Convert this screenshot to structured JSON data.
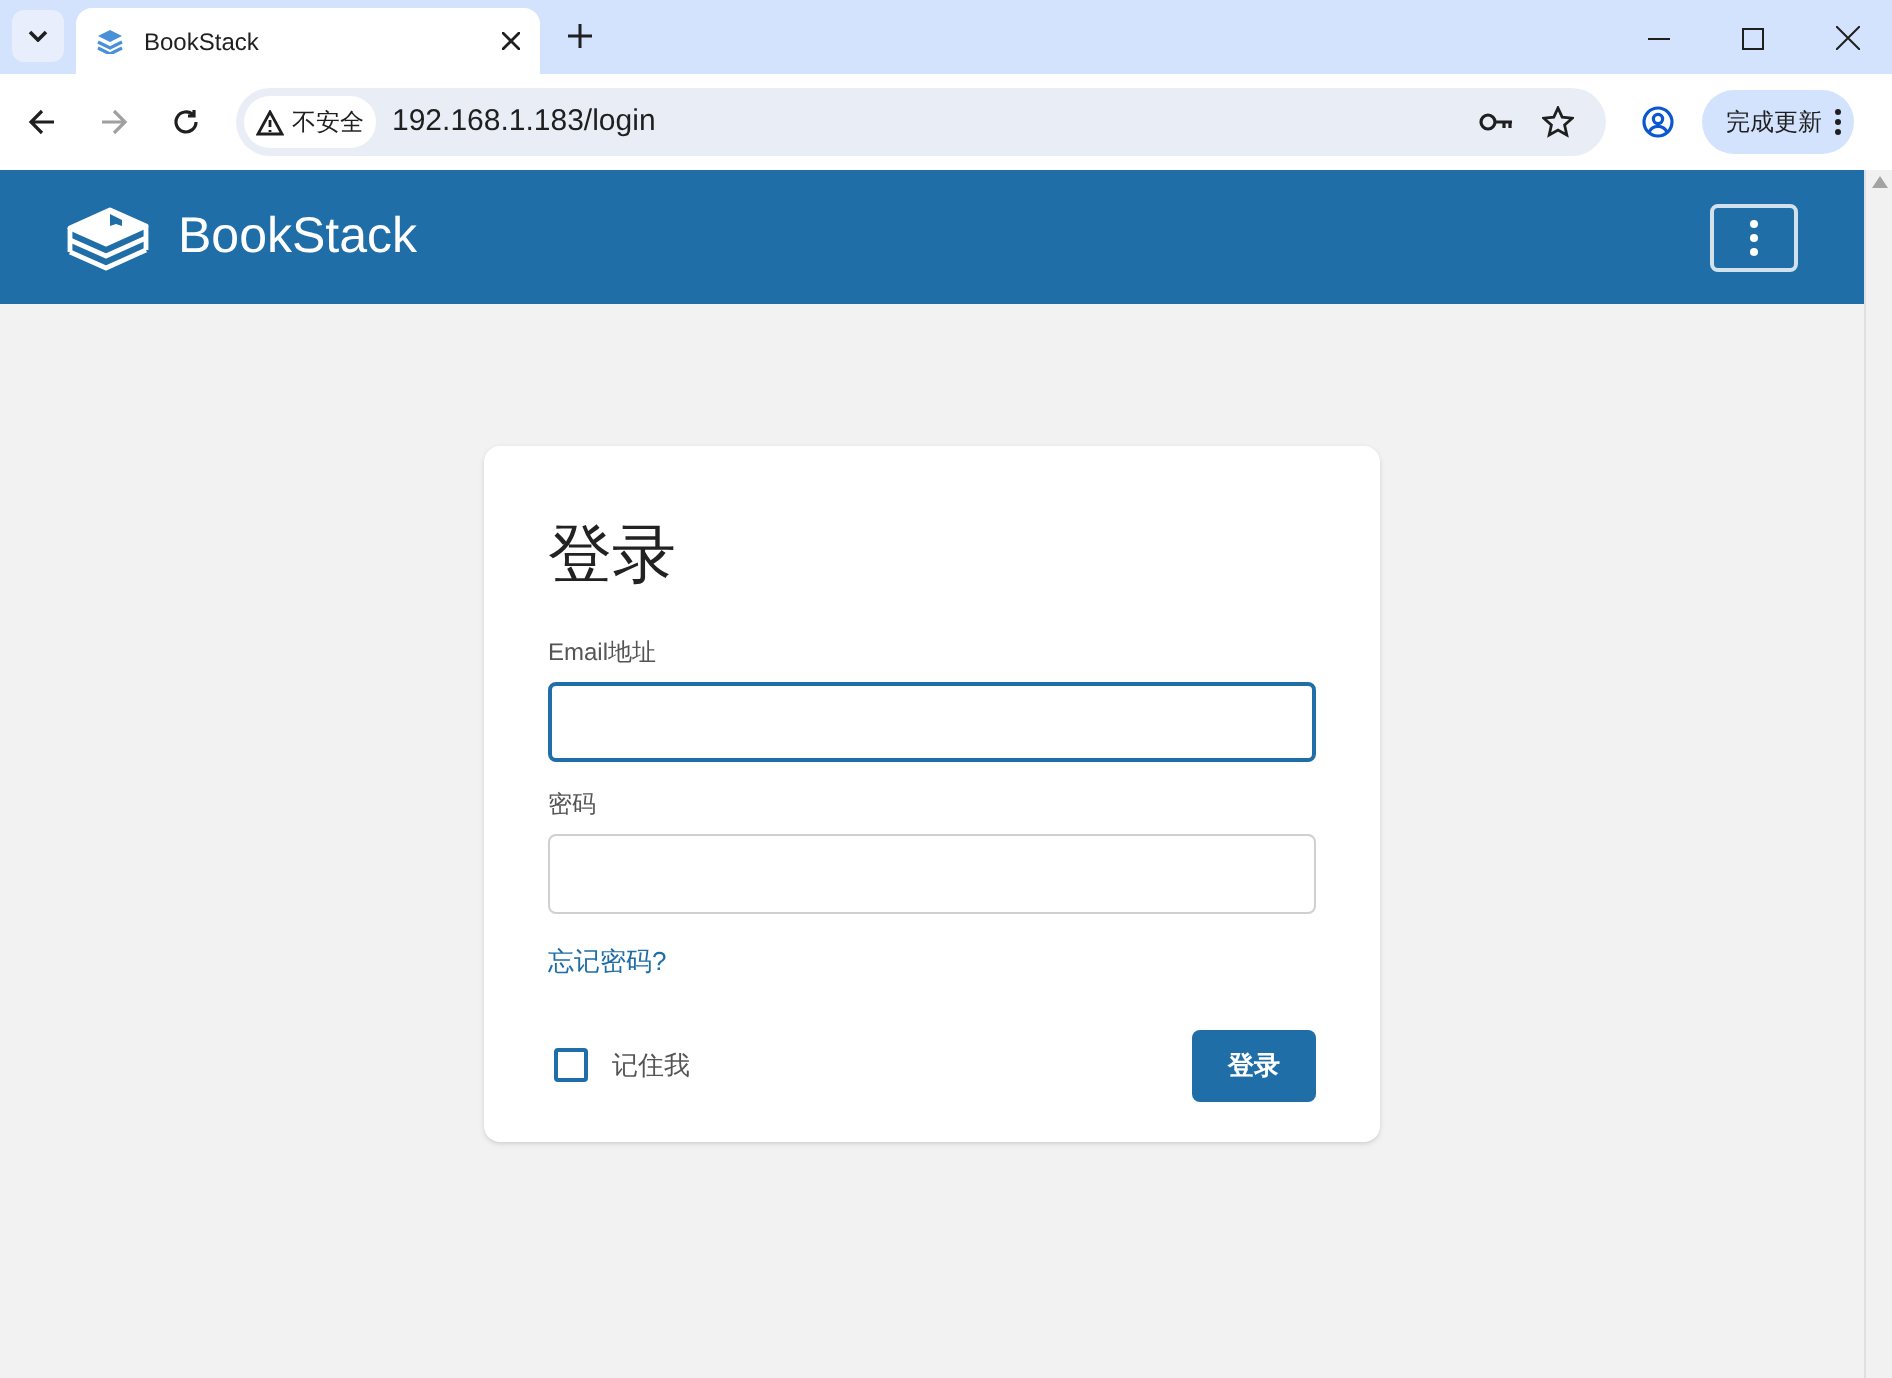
{
  "browser": {
    "tabs": [
      {
        "title": "BookStack",
        "selected": true
      }
    ],
    "security_label": "不安全",
    "url": "192.168.1.183/login",
    "update_button": "完成更新"
  },
  "header": {
    "app_name": "BookStack"
  },
  "login": {
    "title": "登录",
    "fields": [
      {
        "label": "Email地址",
        "focused": true
      },
      {
        "label": "密码",
        "focused": false
      }
    ],
    "forgot_link": "忘记密码?",
    "remember": {
      "label": "记住我",
      "checked": false
    },
    "submit": "登录"
  }
}
